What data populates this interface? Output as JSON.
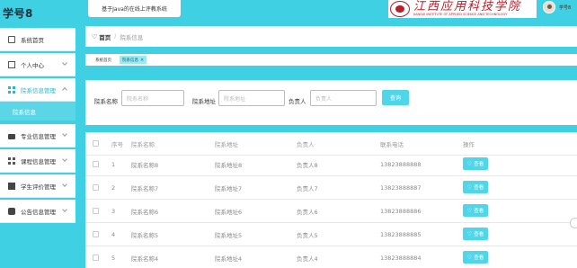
{
  "app": {
    "brand": "学号8"
  },
  "sidebar": {
    "items": [
      {
        "label": "系统首页",
        "icon": "home-icon"
      },
      {
        "label": "个人中心",
        "icon": "person-icon"
      },
      {
        "label": "院系信息管理",
        "icon": "grid-icon"
      },
      {
        "label": "专业信息管理",
        "icon": "briefcase-icon"
      },
      {
        "label": "课程信息管理",
        "icon": "grid-icon"
      },
      {
        "label": "学生评价管理",
        "icon": "book-icon"
      },
      {
        "label": "公告信息管理",
        "icon": "chat-icon"
      }
    ],
    "submenu": {
      "label": "院系信息"
    }
  },
  "header": {
    "system_title": "基于Java的在线上评教系统",
    "school_name_cn": "江西应用科技学院",
    "school_name_en": "JIANGXI INSTITUTE OF APPLIED SCIENCE AND TECHNOLOGY",
    "user_name": "学号8"
  },
  "breadcrumb": {
    "home": "首页",
    "current": "院系信息"
  },
  "tabs": [
    {
      "label": "系统首页"
    },
    {
      "label": "院系信息",
      "close": "×"
    }
  ],
  "search": {
    "name_label": "院系名称",
    "name_placeholder": "院系名称",
    "addr_label": "院系地址",
    "addr_placeholder": "院系地址",
    "head_label": "负责人",
    "head_placeholder": "负责人",
    "button": "查询"
  },
  "table": {
    "headers": {
      "index": "序号",
      "name": "院系名称",
      "addr": "院系地址",
      "head": "负责人",
      "phone": "联系电话",
      "action": "操作"
    },
    "view_label": "查看",
    "rows": [
      {
        "index": "1",
        "name": "院系名称8",
        "addr": "院系地址8",
        "head": "负责人8",
        "phone": "13823888888"
      },
      {
        "index": "2",
        "name": "院系名称7",
        "addr": "院系地址7",
        "head": "负责人7",
        "phone": "13823888887"
      },
      {
        "index": "3",
        "name": "院系名称6",
        "addr": "院系地址6",
        "head": "负责人6",
        "phone": "13823888886"
      },
      {
        "index": "4",
        "name": "院系名称5",
        "addr": "院系地址5",
        "head": "负责人5",
        "phone": "13823888885"
      },
      {
        "index": "5",
        "name": "院系名称4",
        "addr": "院系地址4",
        "head": "负责人4",
        "phone": "13823888884"
      }
    ]
  },
  "colors": {
    "accent": "#3fd0e3",
    "button": "#4fd6e8",
    "active_text": "#29b6d0"
  }
}
